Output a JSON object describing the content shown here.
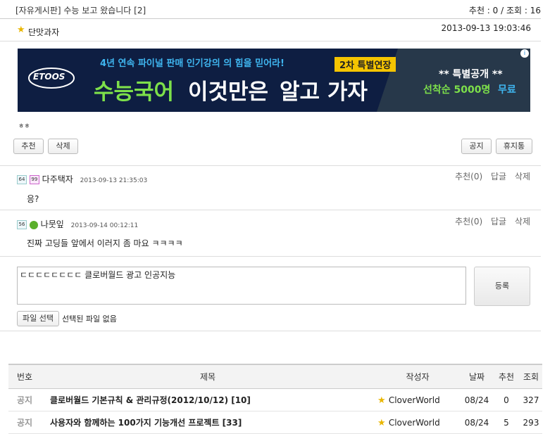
{
  "post": {
    "title": "[자유게시판] 수능 보고 왔습니다 [2]",
    "stats": "추천 : 0 / 조회 : 16",
    "author": "단맛과자",
    "date": "2013-09-13 19:03:46",
    "body": "ㅎㅎ"
  },
  "ad": {
    "brand": "ETOOS",
    "line1": "4년 연속 파이널 판매 인기강의 의 힘을 믿어라!",
    "badge": "2차 특별연장",
    "headline_a": "수능국어",
    "headline_b": "이것만은",
    "headline_c": "알고 가자",
    "side_top": "** 특별공개 **",
    "side_bottom_a": "선착순 5000명",
    "side_bottom_b": "무료"
  },
  "actions": {
    "recommend": "추천",
    "delete": "삭제",
    "notice": "공지",
    "trash": "휴지통"
  },
  "comments": [
    {
      "levels": [
        "64",
        "99"
      ],
      "name": "다주택자",
      "date": "2013-09-13 21:35:03",
      "recommend": "추천(0)",
      "reply": "답글",
      "delete": "삭제",
      "text": "응?"
    },
    {
      "levels": [
        "56"
      ],
      "name": "나뭇잎",
      "date": "2013-09-14 00:12:11",
      "recommend": "추천(0)",
      "reply": "답글",
      "delete": "삭제",
      "text": "진짜 고딩들 앞에서 이러지 좀 마요 ㅋㅋㅋㅋ"
    }
  ],
  "comment_form": {
    "value": "ㄷㄷㄷㄷㄷㄷㄷㄷ 클로버월드 광고 인공지능",
    "submit": "등록",
    "file_button": "파일 선택",
    "file_status": "선택된 파일 없음"
  },
  "board": {
    "headers": [
      "번호",
      "제목",
      "작성자",
      "날짜",
      "추천",
      "조회"
    ],
    "rows": [
      {
        "no": "공지",
        "subject": "클로버월드 기본규칙 & 관리규정(2012/10/12) [10]",
        "author": "CloverWorld",
        "date": "08/24",
        "rec": "0",
        "views": "327"
      },
      {
        "no": "공지",
        "subject": "사용자와 함께하는 100가지 기능개선 프로젝트 [33]",
        "author": "CloverWorld",
        "date": "08/24",
        "rec": "5",
        "views": "293"
      }
    ]
  },
  "colors": {
    "ad_bg": "#0e1e42",
    "ad_badge": "#f5c400",
    "ad_green": "#7de04a",
    "star": "#e9b600"
  }
}
